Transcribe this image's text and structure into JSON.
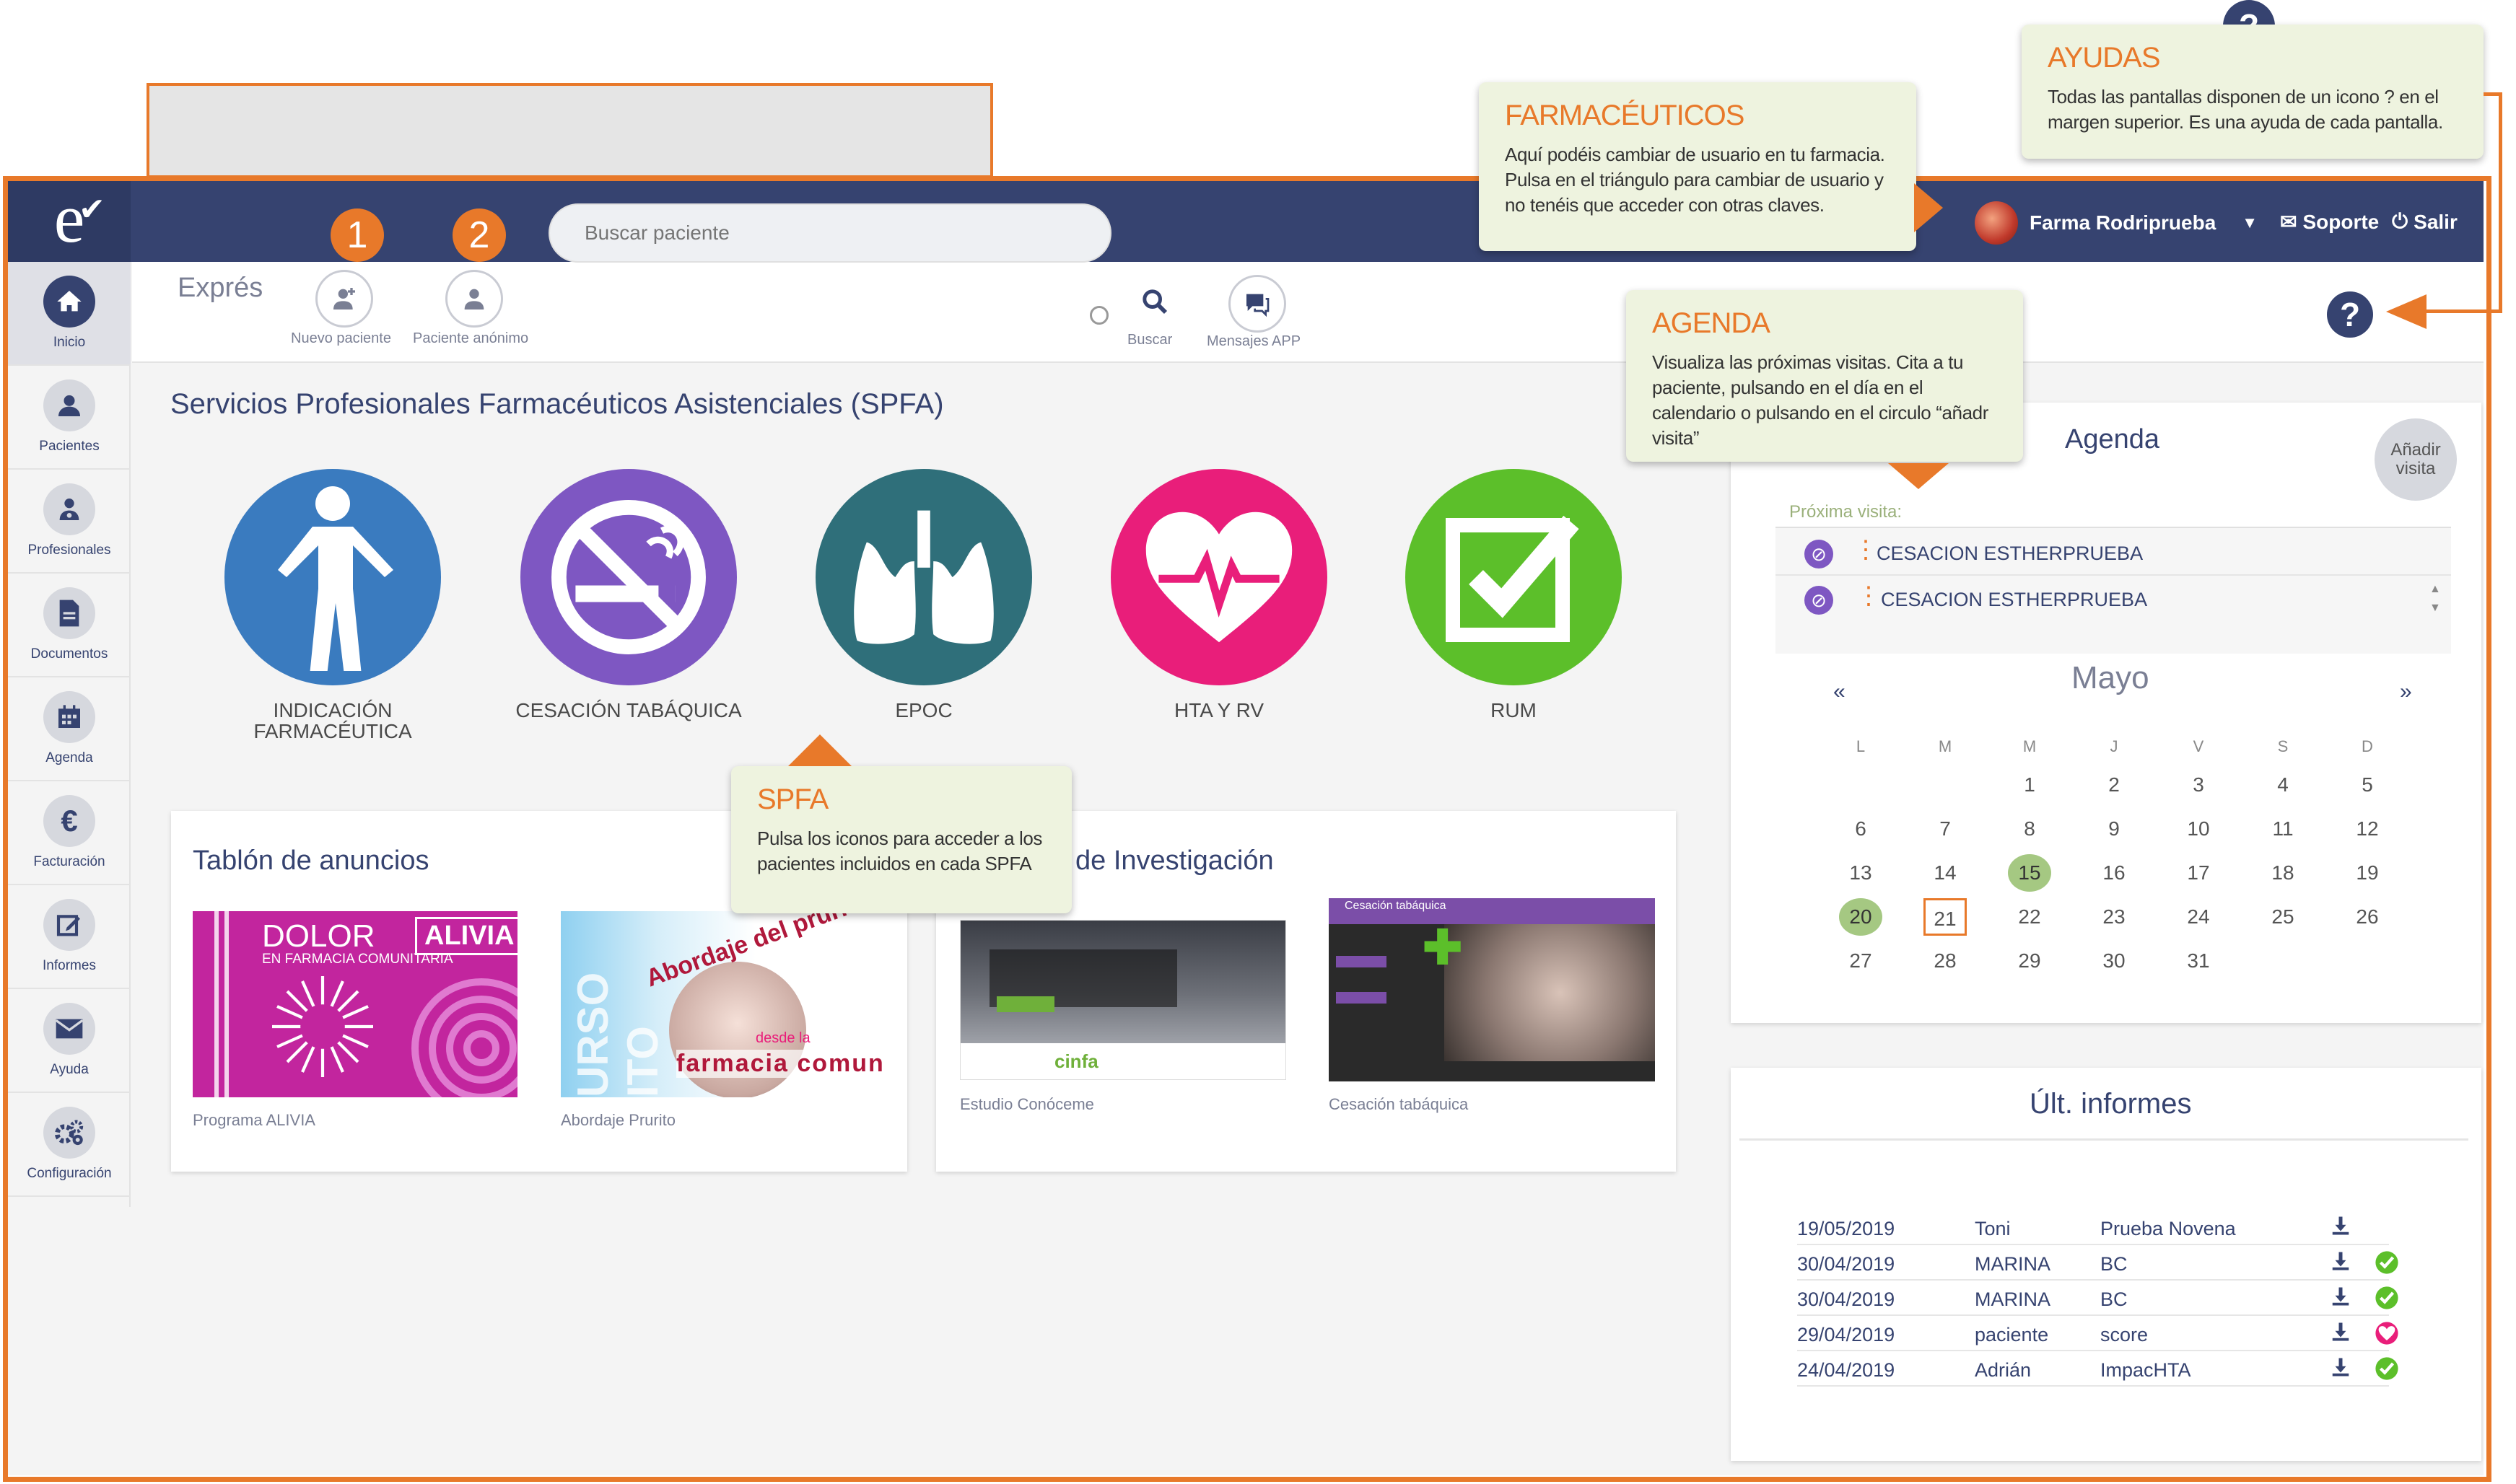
{
  "header": {
    "user_name": "Farma Rodriprueba",
    "support_label": "Soporte",
    "logout_label": "Salir"
  },
  "sidebar": {
    "items": [
      {
        "label": "Inicio",
        "icon": "home-icon"
      },
      {
        "label": "Pacientes",
        "icon": "user-icon"
      },
      {
        "label": "Profesionales",
        "icon": "professionals-icon"
      },
      {
        "label": "Documentos",
        "icon": "document-icon"
      },
      {
        "label": "Agenda",
        "icon": "calendar-icon"
      },
      {
        "label": "Facturación",
        "icon": "euro-icon"
      },
      {
        "label": "Informes",
        "icon": "edit-icon"
      },
      {
        "label": "Ayuda",
        "icon": "envelope-icon"
      },
      {
        "label": "Configuración",
        "icon": "gears-icon"
      }
    ]
  },
  "express": {
    "title": "Exprés",
    "new_patient": "Nuevo paciente",
    "anon_patient": "Paciente anónimo",
    "search_placeholder": "Buscar paciente",
    "search_label": "Buscar",
    "messages_label": "Mensajes APP"
  },
  "spfa": {
    "title": "Servicios Profesionales Farmacéuticos Asistenciales (SPFA)",
    "items": [
      {
        "label": "INDICACIÓN FARMACÉUTICA",
        "color": "#3a7bbf"
      },
      {
        "label": "CESACIÓN TABÁQUICA",
        "color": "#7e57c2"
      },
      {
        "label": "EPOC",
        "color": "#2f6f7a"
      },
      {
        "label": "HTA Y RV",
        "color": "#e91e7a"
      },
      {
        "label": "RUM",
        "color": "#5cbf2a"
      }
    ]
  },
  "board": {
    "title": "Tablón de anuncios",
    "items": [
      {
        "caption": "Programa ALIVIA",
        "thumb_title": "DOLOR",
        "thumb_sub": "EN FARMACIA COMUNITARIA",
        "thumb_brand": "ALIVIA"
      },
      {
        "caption": "Abordaje Prurito",
        "thumb_title": "Abordaje del prurito",
        "thumb_sub": "farmacia comunitaria",
        "thumb_brand": "desde la",
        "thumb_side": "URSO ITO"
      }
    ]
  },
  "research": {
    "title": "de Investigación",
    "items": [
      {
        "caption": "Estudio Conóceme",
        "thumb_brand": "cinfa"
      },
      {
        "caption": "Cesación tabáquica",
        "thumb_title": "Cesación tabáquica"
      }
    ]
  },
  "agenda": {
    "title": "Agenda",
    "add_visit": "Añadir visita",
    "next_label": "Próxima visita:",
    "visits": [
      "CESACION ESTHERPRUEBA",
      "CESACION ESTHERPRUEBA"
    ],
    "month": "Mayo",
    "prev": "«",
    "next": "»",
    "weekdays": [
      "L",
      "M",
      "M",
      "J",
      "V",
      "S",
      "D"
    ],
    "weeks": [
      [
        "",
        "",
        "1",
        "2",
        "3",
        "4",
        "5"
      ],
      [
        "6",
        "7",
        "8",
        "9",
        "10",
        "11",
        "12"
      ],
      [
        "13",
        "14",
        "15",
        "16",
        "17",
        "18",
        "19"
      ],
      [
        "20",
        "21",
        "22",
        "23",
        "24",
        "25",
        "26"
      ],
      [
        "27",
        "28",
        "29",
        "30",
        "31",
        "",
        ""
      ]
    ],
    "highlighted": [
      "15",
      "20"
    ],
    "today": "21"
  },
  "reports": {
    "title": "Últ. informes",
    "rows": [
      {
        "date": "19/05/2019",
        "name": "Toni",
        "type": "Prueba Novena",
        "status": ""
      },
      {
        "date": "30/04/2019",
        "name": "MARINA",
        "type": "BC",
        "status": "check"
      },
      {
        "date": "30/04/2019",
        "name": "MARINA",
        "type": "BC",
        "status": "check"
      },
      {
        "date": "29/04/2019",
        "name": "paciente",
        "type": "score",
        "status": "heart"
      },
      {
        "date": "24/04/2019",
        "name": "Adrián",
        "type": "ImpacHTA",
        "status": "check"
      }
    ]
  },
  "tooltips": {
    "ayudas": {
      "title": "AYUDAS",
      "body": "Todas las pantallas disponen de un icono ? en el margen superior. Es una ayuda de cada pantalla."
    },
    "farmaceuticos": {
      "title": "FARMACÉUTICOS",
      "body": "Aquí podéis cambiar de usuario en tu farmacia. Pulsa en el triángulo para cambiar de usuario y no tenéis que acceder con otras claves."
    },
    "agenda": {
      "title": "AGENDA",
      "body": "Visualiza las próximas visitas. Cita a tu paciente, pulsando en el día en el calendario o pulsando en el circulo “añadr visita”"
    },
    "spfa": {
      "title": "SPFA",
      "body": "Pulsa los iconos para acceder a los pacientes incluidos en cada SPFA"
    }
  },
  "badges": [
    "1",
    "2"
  ],
  "help_mark": "?",
  "colors": {
    "navy": "#364370",
    "orange": "#e8792a",
    "tip_bg": "#eef3df",
    "highlight": "#a5c882"
  }
}
